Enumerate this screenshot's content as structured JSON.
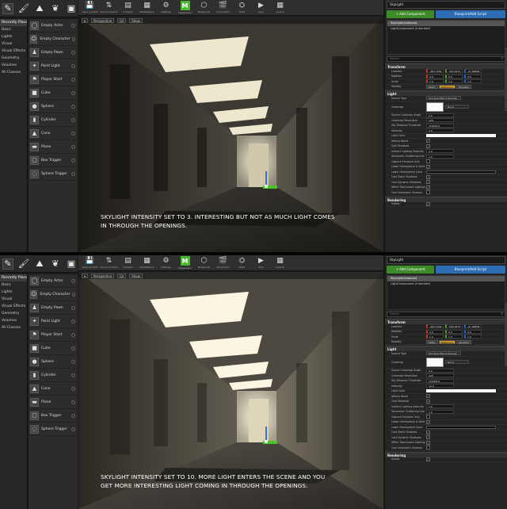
{
  "panels": [
    {
      "caption_lines": [
        "SKYLIGHT INTENSITY SET TO 3. INTERESTING BUT NOT AS MUCH LIGHT COMES",
        "IN THROUGH THE OPENINGS."
      ],
      "intensity": "3.0"
    },
    {
      "caption_lines": [
        "SKYLIGHT INTENSITY SET TO 10. MORE LIGHT ENTERS THE SCENE AND YOU",
        "GET MORE INTERESTING LIGHT COMING IN THROUGH THE OPENINGS."
      ],
      "intensity": "10.0"
    }
  ],
  "modes_panel": {
    "search_label": "Recently Placed",
    "categories": [
      "Basic",
      "Lights",
      "Visual",
      "Visual Effects",
      "Geometry",
      "Volumes",
      "All Classes"
    ],
    "placeables": [
      "Empty Actor",
      "Empty Character",
      "Empty Pawn",
      "Point Light",
      "Player Start",
      "Cube",
      "Sphere",
      "Cylinder",
      "Cone",
      "Plane",
      "Box Trigger",
      "Sphere Trigger"
    ]
  },
  "toolbar": [
    {
      "label": "Save Current",
      "icon": "save-icon"
    },
    {
      "label": "Source Control",
      "icon": "source-control-icon"
    },
    {
      "label": "Content",
      "icon": "content-icon"
    },
    {
      "label": "Marketplace",
      "icon": "marketplace-icon"
    },
    {
      "label": "Settings",
      "icon": "settings-icon"
    },
    {
      "label": "Megascans",
      "icon": "megascans-icon"
    },
    {
      "label": "Blueprints",
      "icon": "blueprints-icon"
    },
    {
      "label": "Cinematics",
      "icon": "cinematics-icon"
    },
    {
      "label": "Build",
      "icon": "build-icon"
    },
    {
      "label": "Play",
      "icon": "play-icon"
    },
    {
      "label": "Launch",
      "icon": "launch-icon"
    }
  ],
  "viewport": {
    "perspective": "Perspective",
    "lit": "Lit",
    "show": "Show"
  },
  "details": {
    "actor_name": "SkyLight",
    "add_component": "+ Add Component",
    "blueprint_button": "Blueprint/Add Script",
    "components": [
      "SkyLight(Instance)",
      "LightComponent (Inherited)"
    ],
    "search_placeholder": "Search",
    "transform_section": "Transform",
    "transform_rows": [
      {
        "label": "Location",
        "x": "-460.7469",
        "y": "-503.6470",
        "z": "-91.88806"
      },
      {
        "label": "Rotation",
        "x": "0.0",
        "y": "0.0",
        "z": "0.0"
      },
      {
        "label": "Scale",
        "x": "1.0",
        "y": "1.0",
        "z": "1.0"
      }
    ],
    "mobility_label": "Mobility",
    "mobility": [
      "Static",
      "Stationary",
      "Movable"
    ],
    "light_section": "Light",
    "source_type_label": "Source Type",
    "source_type": "SLS Specified Cubemap",
    "cubemap_label": "Cubemap",
    "cubemap_name": "None",
    "light_rows": [
      "Source Cubemap Angle",
      "Cubemap Resolution",
      "Sky Distance Threshold",
      "Intensity",
      "Light Color",
      "Affects World",
      "Cast Shadows",
      "Indirect Lighting Intensity",
      "Volumetric Scattering Inte"
    ],
    "light_values": [
      "0.0",
      "128",
      "150000.0",
      "",
      "",
      "",
      "",
      "1.0",
      "1.0"
    ],
    "lower_rows": [
      "Capture Emissive Only",
      "Lower Hemisphere Is Solid",
      "Lower Hemisphere Color",
      "Cast Static Shadows",
      "Cast Dynamic Shadows",
      "Affect Translucent Lighting",
      "Cast Volumetric Shadow"
    ],
    "rendering_section": "Rendering",
    "visible_label": "Visible"
  }
}
